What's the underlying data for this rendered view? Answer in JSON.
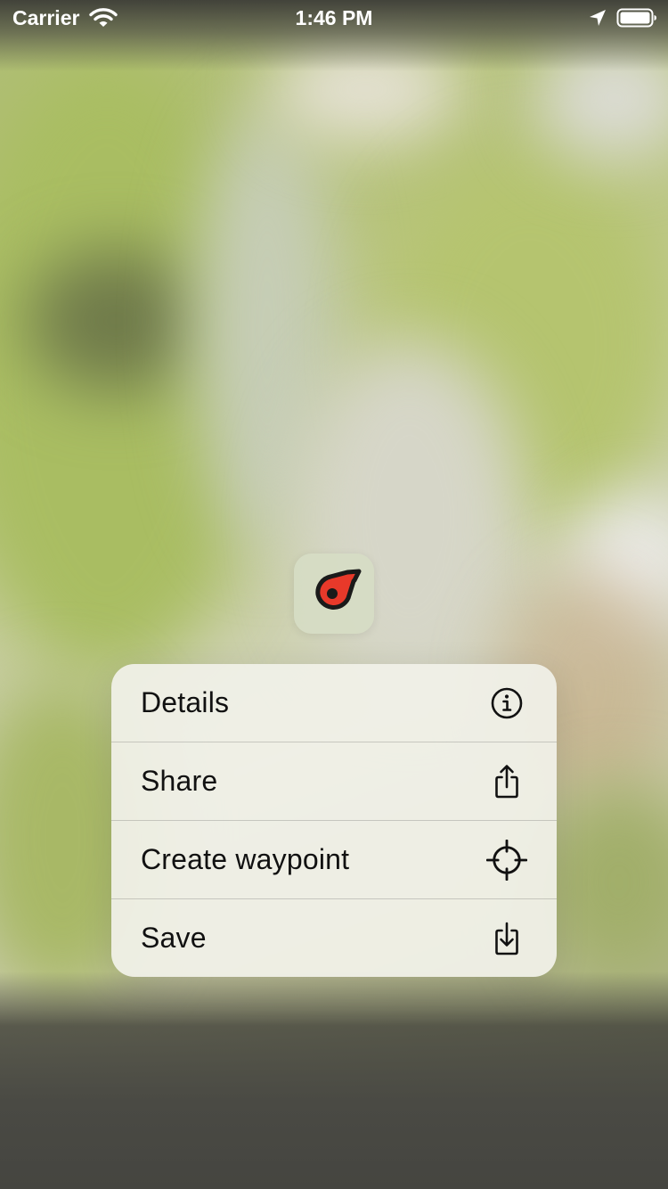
{
  "status_bar": {
    "carrier": "Carrier",
    "time": "1:46 PM",
    "icons": [
      "wifi-icon",
      "location-arrow-icon",
      "battery-icon"
    ]
  },
  "preview": {
    "icon": "waypoint-pin-icon",
    "pin_color": "#e8392a"
  },
  "context_menu": {
    "items": [
      {
        "label": "Details",
        "icon": "info-circle-icon"
      },
      {
        "label": "Share",
        "icon": "share-icon"
      },
      {
        "label": "Create waypoint",
        "icon": "crosshair-icon"
      },
      {
        "label": "Save",
        "icon": "save-icon"
      }
    ]
  }
}
